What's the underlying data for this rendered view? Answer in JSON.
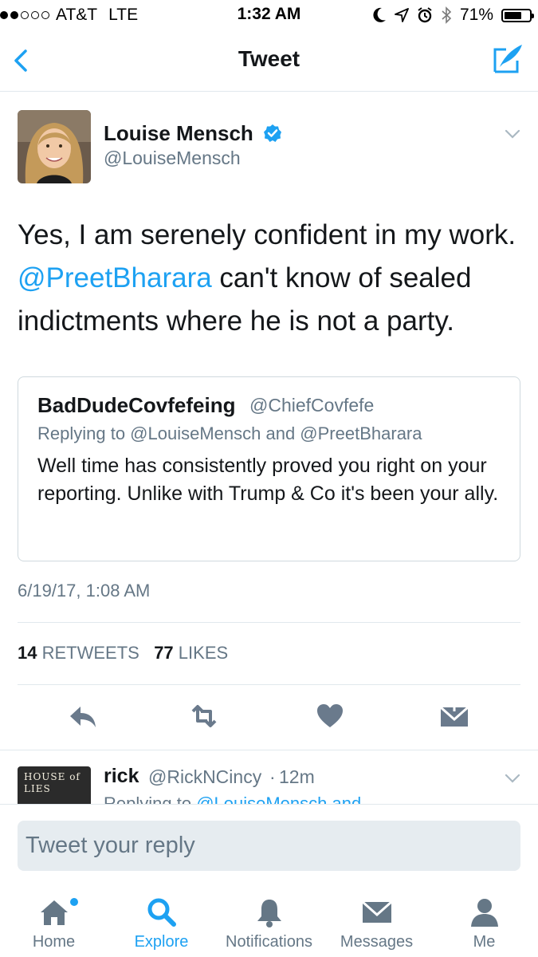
{
  "status_bar": {
    "carrier": "AT&T",
    "network": "LTE",
    "time": "1:32 AM",
    "battery": "71%",
    "battery_level": 0.71,
    "signal_bars": 2
  },
  "nav": {
    "title": "Tweet",
    "back_icon": "chevron-left-icon",
    "compose_icon": "compose-icon"
  },
  "tweet": {
    "author_name": "Louise Mensch",
    "author_handle": "@LouiseMensch",
    "text_before": "Yes, I am serenely confident in my work. ",
    "mention": "@PreetBharara",
    "text_after": " can't know of sealed indictments where he is not a party.",
    "timestamp": "6/19/17, 1:08 AM",
    "retweet_count": "14",
    "retweet_label": "RETWEETS",
    "like_count": "77",
    "like_label": "LIKES"
  },
  "quoted": {
    "name": "BadDudeCovfefeing",
    "handle": "@ChiefCovfefe",
    "replying": "Replying to @LouiseMensch and @PreetBharara",
    "text": "Well time has consistently proved you right on your reporting. Unlike with Trump & Co it's been your ally."
  },
  "reply_preview": {
    "name": "rick",
    "handle": "@RickNCincy",
    "separator": "·",
    "time": "12m",
    "replying_prefix": "Replying to ",
    "replying_mention": "@LouiseMensch and",
    "avatar_text": "HOUSE of LIES"
  },
  "reply_bar": {
    "placeholder": "Tweet your reply"
  },
  "tabs": [
    {
      "label": "Home",
      "icon": "home-icon"
    },
    {
      "label": "Explore",
      "icon": "search-icon"
    },
    {
      "label": "Notifications",
      "icon": "bell-icon"
    },
    {
      "label": "Messages",
      "icon": "envelope-icon"
    },
    {
      "label": "Me",
      "icon": "person-icon"
    }
  ],
  "colors": {
    "accent": "#1da1f2",
    "text": "#14171a",
    "muted": "#657786",
    "divider": "#e1e8ed",
    "action_icon": "#6a7a8c"
  }
}
